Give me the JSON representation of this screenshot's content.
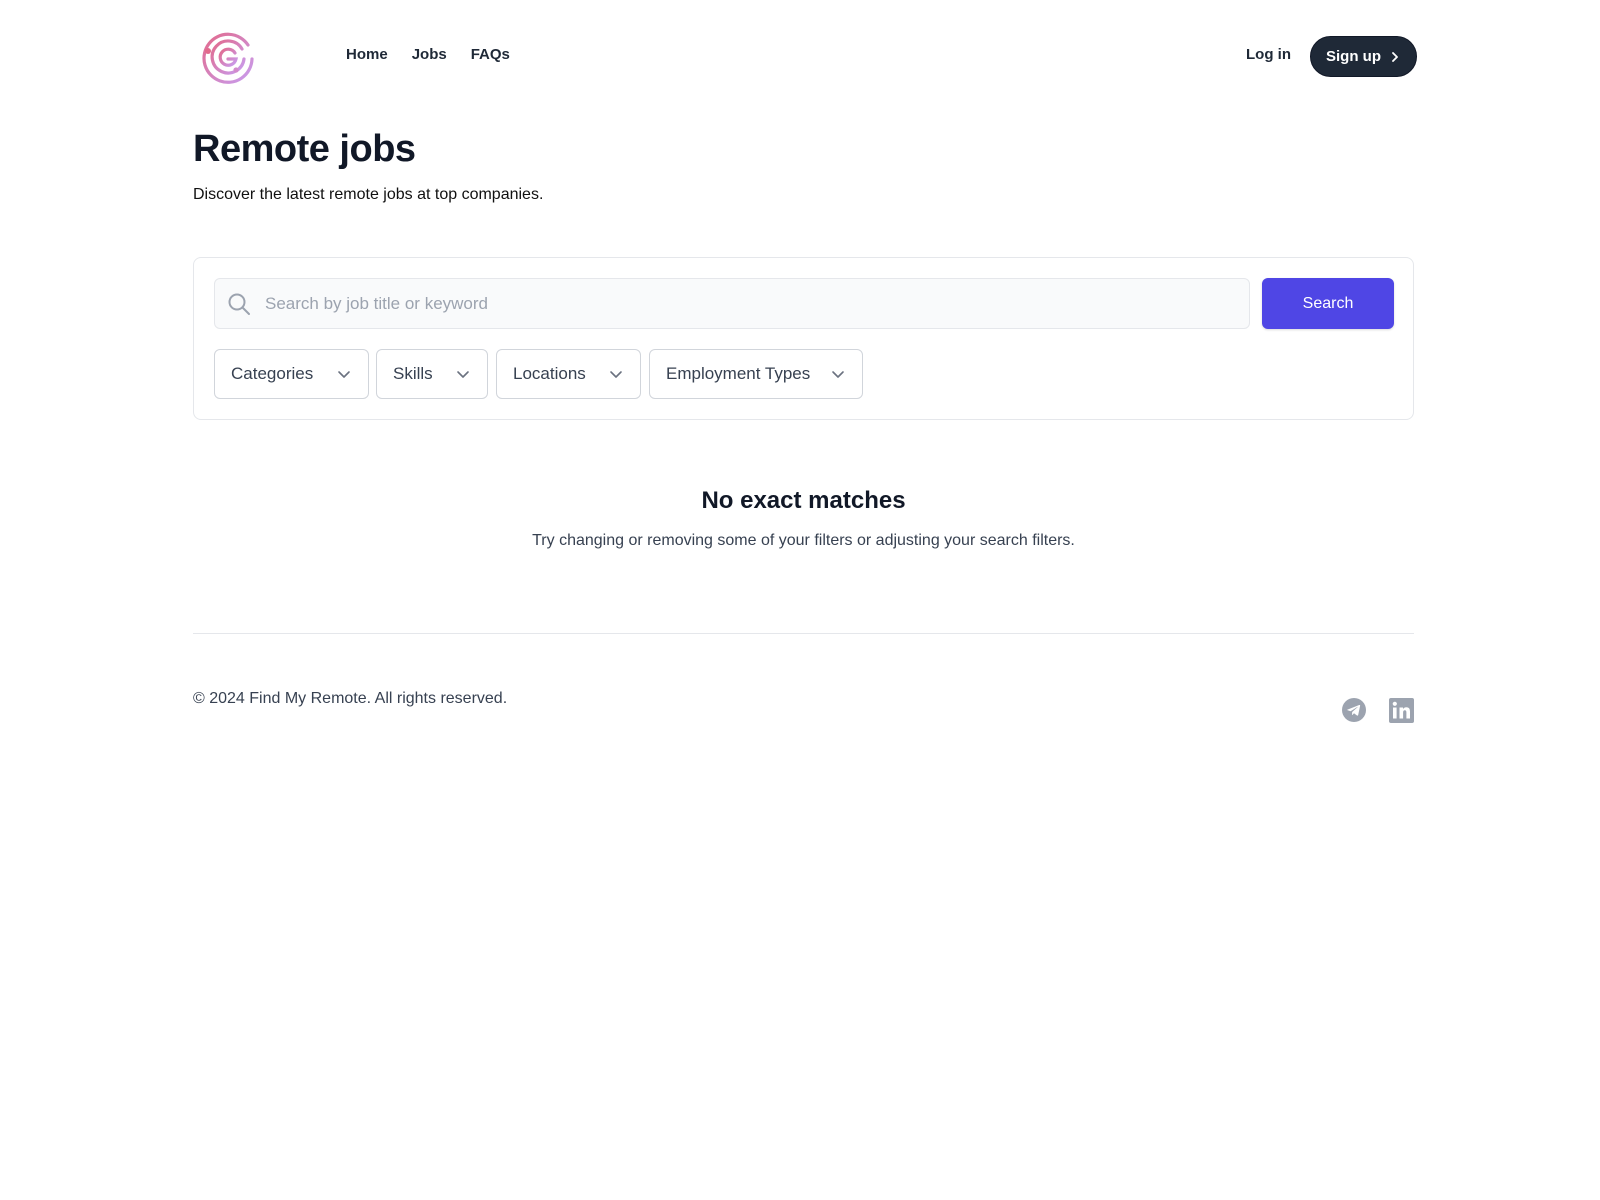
{
  "header": {
    "nav": [
      {
        "label": "Home"
      },
      {
        "label": "Jobs"
      },
      {
        "label": "FAQs"
      }
    ],
    "login_label": "Log in",
    "signup_label": "Sign up"
  },
  "page": {
    "title": "Remote jobs",
    "subtitle": "Discover the latest remote jobs at top companies."
  },
  "search": {
    "placeholder": "Search by job title or keyword",
    "value": "",
    "button_label": "Search",
    "filters": [
      {
        "label": "Categories"
      },
      {
        "label": "Skills"
      },
      {
        "label": "Locations"
      },
      {
        "label": "Employment Types"
      }
    ]
  },
  "empty_state": {
    "title": "No exact matches",
    "message": "Try changing or removing some of your filters or adjusting your search filters."
  },
  "footer": {
    "copyright": "© 2024 Find My Remote. All rights reserved.",
    "social": [
      {
        "icon": "telegram-icon"
      },
      {
        "icon": "linkedin-icon"
      }
    ]
  },
  "colors": {
    "accent": "#4f46e5",
    "dark": "#1f2937",
    "icon_gray": "#9ca3af",
    "logo_gradient": [
      "#e26a8c",
      "#c89df0"
    ]
  }
}
